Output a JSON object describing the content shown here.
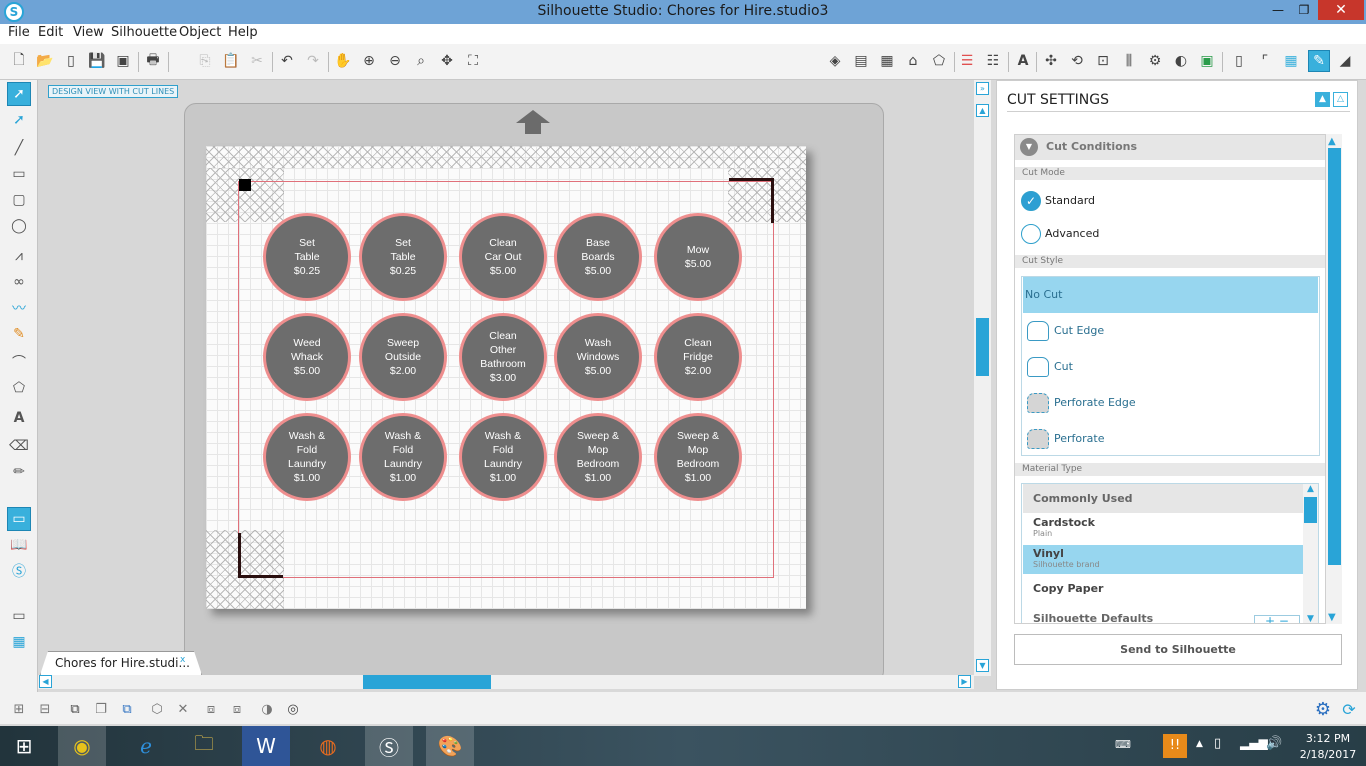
{
  "window": {
    "title": "Silhouette Studio: Chores for Hire.studio3",
    "app_icon": "S"
  },
  "menu": [
    "File",
    "Edit",
    "View",
    "Silhouette",
    "Object",
    "Help"
  ],
  "view_label": "DESIGN VIEW WITH CUT LINES",
  "doc_tab": "Chores for Hire.studi...",
  "doc_tab_close": "x",
  "circles": [
    [
      "Set\nTable\n$0.25",
      "Set\nTable\n$0.25",
      "Clean\nCar Out\n$5.00",
      "Base\nBoards\n$5.00",
      "Mow\n$5.00"
    ],
    [
      "Weed\nWhack\n$5.00",
      "Sweep\nOutside\n$2.00",
      "Clean\nOther\nBathroom\n$3.00",
      "Wash\nWindows\n$5.00",
      "Clean\nFridge\n$2.00"
    ],
    [
      "Wash &\nFold\nLaundry\n$1.00",
      "Wash &\nFold\nLaundry\n$1.00",
      "Wash &\nFold\nLaundry\n$1.00",
      "Sweep &\nMop\nBedroom\n$1.00",
      "Sweep &\nMop\nBedroom\n$1.00"
    ]
  ],
  "cut_panel": {
    "title": "CUT SETTINGS",
    "conditions_title": "Cut Conditions",
    "cut_mode_label": "Cut Mode",
    "modes": [
      {
        "label": "Standard",
        "selected": true
      },
      {
        "label": "Advanced",
        "selected": false
      }
    ],
    "cut_style_label": "Cut Style",
    "styles": [
      {
        "label": "No Cut",
        "selected": true
      },
      {
        "label": "Cut Edge"
      },
      {
        "label": "Cut"
      },
      {
        "label": "Perforate Edge"
      },
      {
        "label": "Perforate"
      }
    ],
    "material_type_label": "Material Type",
    "materials": [
      {
        "label": "Commonly Used",
        "sub": ""
      },
      {
        "label": "Cardstock",
        "sub": "Plain"
      },
      {
        "label": "Vinyl",
        "sub": "Silhouette brand",
        "selected": true
      },
      {
        "label": "Copy Paper",
        "sub": ""
      },
      {
        "label": "Silhouette Defaults",
        "sub": ""
      }
    ],
    "send_button": "Send to Silhouette"
  },
  "clock": {
    "time": "3:12 PM",
    "date": "2/18/2017"
  },
  "colors": {
    "accent": "#39b0dc",
    "circle_fill": "#6d6d6d",
    "circle_stroke": "#ee8e8e",
    "cut_line": "#e0707a",
    "title_bar": "#6ea3d6"
  }
}
